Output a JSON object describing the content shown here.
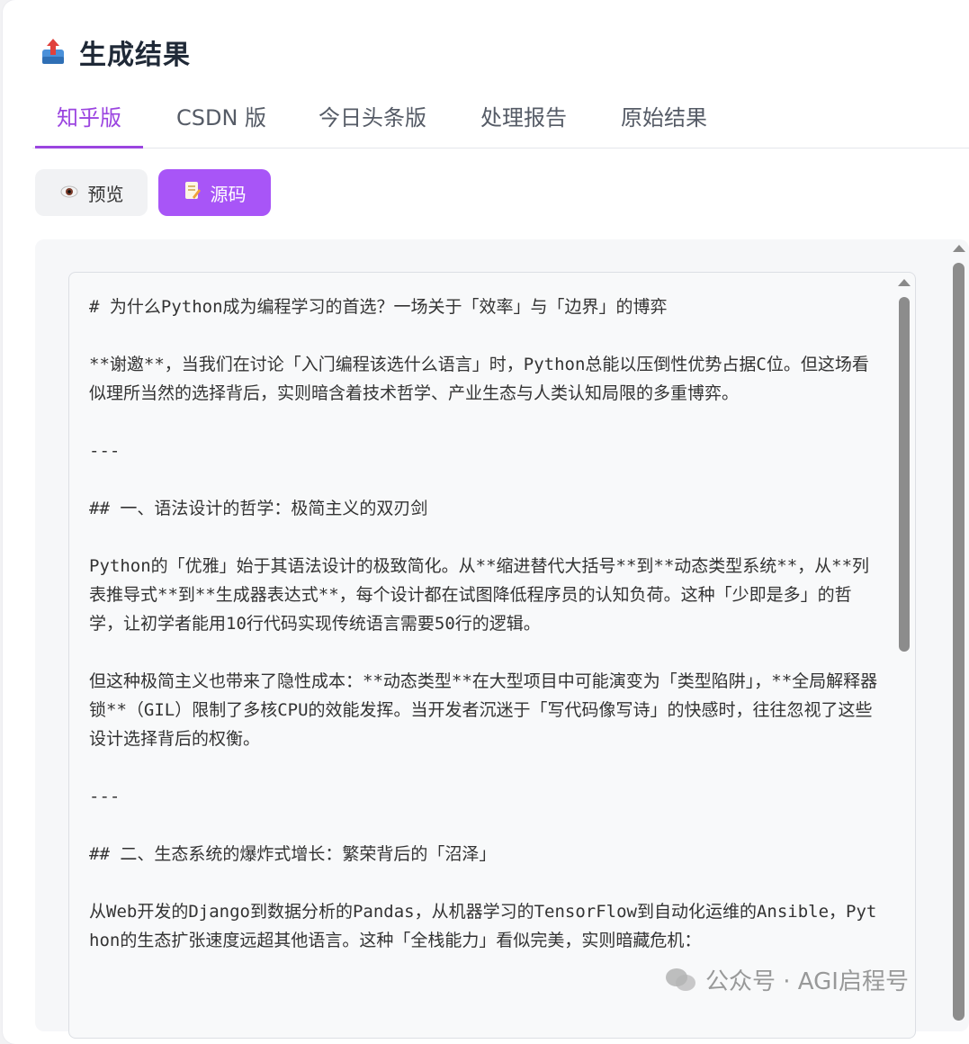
{
  "header": {
    "title": "生成结果",
    "icon": "upload-tray-icon"
  },
  "tabs": [
    {
      "label": "知乎版",
      "active": true
    },
    {
      "label": "CSDN 版",
      "active": false
    },
    {
      "label": "今日头条版",
      "active": false
    },
    {
      "label": "处理报告",
      "active": false
    },
    {
      "label": "原始结果",
      "active": false
    }
  ],
  "view_buttons": {
    "preview": {
      "label": "预览",
      "icon": "eye-icon"
    },
    "source": {
      "label": "源码",
      "icon": "document-edit-icon",
      "active": true
    }
  },
  "source_text": "# 为什么Python成为编程学习的首选？一场关于「效率」与「边界」的博弈\n\n**谢邀**，当我们在讨论「入门编程该选什么语言」时，Python总能以压倒性优势占据C位。但这场看似理所当然的选择背后，实则暗含着技术哲学、产业生态与人类认知局限的多重博弈。\n\n---\n\n## 一、语法设计的哲学：极简主义的双刃剑\n\nPython的「优雅」始于其语法设计的极致简化。从**缩进替代大括号**到**动态类型系统**，从**列表推导式**到**生成器表达式**，每个设计都在试图降低程序员的认知负荷。这种「少即是多」的哲学，让初学者能用10行代码实现传统语言需要50行的逻辑。\n\n但这种极简主义也带来了隐性成本：**动态类型**在大型项目中可能演变为「类型陷阱」，**全局解释器锁**（GIL）限制了多核CPU的效能发挥。当开发者沉迷于「写代码像写诗」的快感时，往往忽视了这些设计选择背后的权衡。\n\n---\n\n## 二、生态系统的爆炸式增长：繁荣背后的「沼泽」\n\n从Web开发的Django到数据分析的Pandas，从机器学习的TensorFlow到自动化运维的Ansible，Python的生态扩张速度远超其他语言。这种「全栈能力」看似完美，实则暗藏危机：",
  "watermark": {
    "text": "公众号 · AGI启程号",
    "icon": "wechat-icon"
  },
  "colors": {
    "accent": "#a855f7",
    "tab_active": "#9b45e0"
  }
}
